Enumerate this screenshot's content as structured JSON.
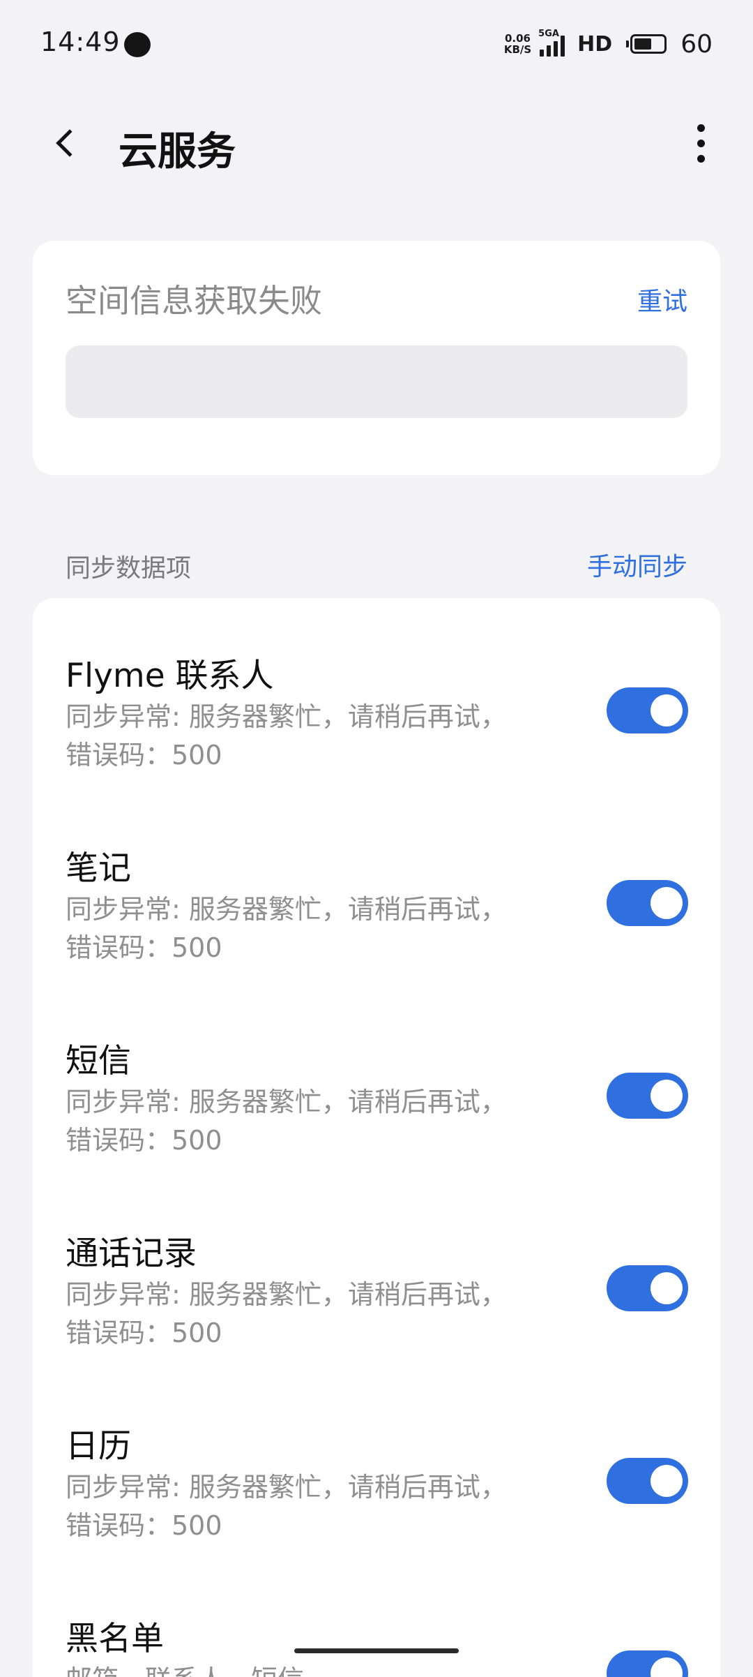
{
  "status_bar": {
    "time": "14:49",
    "net_speed_value": "0.06",
    "net_speed_unit": "KB/S",
    "signal_label": "5GA",
    "hd_label": "HD",
    "battery_level": "60",
    "battery_fraction": 0.6
  },
  "header": {
    "title": "云服务",
    "back_icon": "chevron-left-icon",
    "more_icon": "more-vertical-icon"
  },
  "storage": {
    "status_text": "空间信息获取失败",
    "retry_label": "重试"
  },
  "sync_section": {
    "label": "同步数据项",
    "manual_sync_label": "手动同步"
  },
  "sync_items": [
    {
      "title": "Flyme 联系人",
      "desc_line1": "同步异常: 服务器繁忙，请稍后再试，",
      "desc_line2": "错误码：500",
      "enabled": true
    },
    {
      "title": "笔记",
      "desc_line1": "同步异常: 服务器繁忙，请稍后再试，",
      "desc_line2": "错误码：500",
      "enabled": true
    },
    {
      "title": "短信",
      "desc_line1": "同步异常: 服务器繁忙，请稍后再试，",
      "desc_line2": "错误码：500",
      "enabled": true
    },
    {
      "title": "通话记录",
      "desc_line1": "同步异常: 服务器繁忙，请稍后再试，",
      "desc_line2": "错误码：500",
      "enabled": true
    },
    {
      "title": "日历",
      "desc_line1": "同步异常: 服务器繁忙，请稍后再试，",
      "desc_line2": "错误码：500",
      "enabled": true
    },
    {
      "title": "黑名单",
      "desc_line1": "邮箱、联系人、短信",
      "desc_line2": "",
      "enabled": true
    }
  ],
  "colors": {
    "accent": "#2f6fe0",
    "background": "#f3f3f5",
    "card": "#ffffff"
  }
}
